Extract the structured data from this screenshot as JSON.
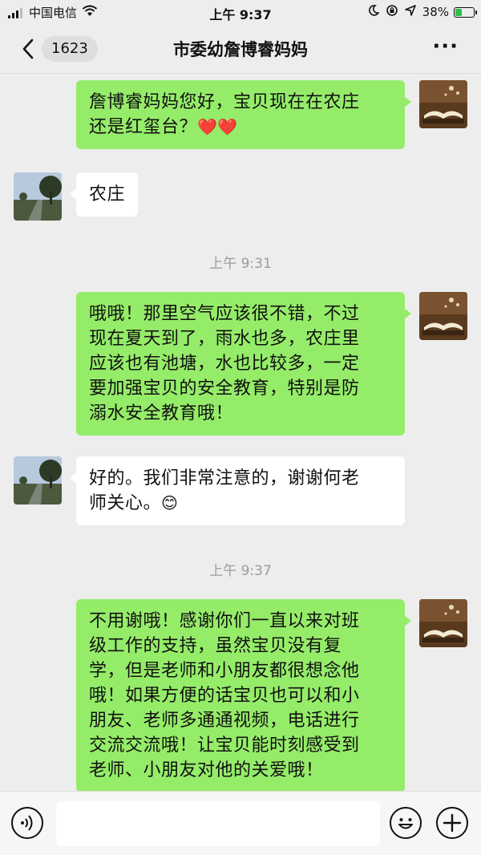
{
  "status_bar": {
    "carrier": "中国电信",
    "time": "上午 9:37",
    "battery": "38%",
    "battery_level": 0.38
  },
  "nav": {
    "unread_count": "1623",
    "title": "市委幼詹博睿妈妈"
  },
  "messages": [
    {
      "side": "out",
      "text_lines": [
        "詹博睿妈妈您好，宝贝现在在农庄",
        "还是红玺台？"
      ],
      "emoji": "❤️❤️"
    },
    {
      "side": "in",
      "text_lines": [
        "农庄"
      ]
    },
    {
      "timestamp": "上午 9:31"
    },
    {
      "side": "out",
      "text_lines": [
        "哦哦！那里空气应该很不错，不过",
        "现在夏天到了，雨水也多，农庄里",
        "应该也有池塘，水也比较多，一定",
        "要加强宝贝的安全教育，特别是防",
        "溺水安全教育哦！"
      ]
    },
    {
      "side": "in",
      "text_lines": [
        "好的。我们非常注意的，谢谢何老",
        "师关心。"
      ],
      "emoji": "😊"
    },
    {
      "timestamp": "上午 9:37"
    },
    {
      "side": "out",
      "text_lines": [
        "不用谢哦！感谢你们一直以来对班",
        "级工作的支持，虽然宝贝没有复",
        "学，但是老师和小朋友都很想念他",
        "哦！如果方便的话宝贝也可以和小",
        "朋友、老师多通通视频，电话进行",
        "交流交流哦！让宝贝能时刻感受到",
        "老师、小朋友对他的关爱哦！"
      ]
    }
  ],
  "input": {
    "value": "",
    "voice_icon": "voice-icon",
    "emoji_icon": "emoji-icon",
    "plus_icon": "plus-icon"
  },
  "colors": {
    "outgoing_bubble": "#95ec69",
    "incoming_bubble": "#ffffff",
    "background": "#ededed"
  }
}
